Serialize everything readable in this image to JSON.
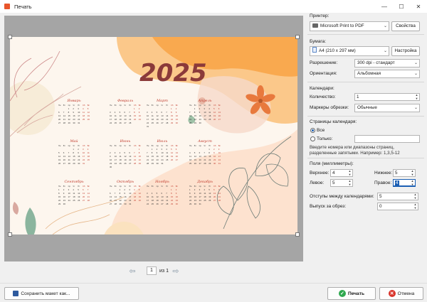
{
  "window": {
    "title": "Печать"
  },
  "calendar": {
    "year": "2025",
    "weekdays": [
      "Пн",
      "Вт",
      "Ср",
      "Чт",
      "Пт",
      "Сб",
      "Вс"
    ],
    "months": [
      "Январь",
      "Февраль",
      "Март",
      "Апрель",
      "Май",
      "Июнь",
      "Июль",
      "Август",
      "Сентябрь",
      "Октябрь",
      "Ноябрь",
      "Декабрь"
    ]
  },
  "pager": {
    "current": "1",
    "total_label": "из 1"
  },
  "printer": {
    "label": "Принтер:",
    "value": "Microsoft Print to PDF",
    "properties_button": "Свойства"
  },
  "paper": {
    "label": "Бумага:",
    "value": "A4 (210 x 297 мм)",
    "setup_button": "Настройка",
    "resolution_label": "Разрешение:",
    "resolution_value": "300 dpi - стандарт",
    "orientation_label": "Ориентация:",
    "orientation_value": "Альбомная"
  },
  "calendars": {
    "label": "Календари:",
    "count_label": "Количество:",
    "count_value": "1",
    "marks_label": "Маркеры обрезки:",
    "marks_value": "Обычные"
  },
  "pages": {
    "label": "Страницы календаря:",
    "all_label": "Все",
    "only_label": "Только:",
    "hint": "Введите номера или диапазоны страниц, разделенные запятыми. Например: 1,3,5-12"
  },
  "margins": {
    "label": "Поля (миллиметры):",
    "top_label": "Верхнее:",
    "top_value": "4",
    "bottom_label": "Нижнее:",
    "bottom_value": "5",
    "left_label": "Левое:",
    "left_value": "5",
    "right_label": "Правое:",
    "right_value": "4",
    "gap_label": "Отступы между календарями:",
    "gap_value": "5",
    "bleed_label": "Выпуск за обрез:",
    "bleed_value": "0"
  },
  "footer": {
    "save_layout": "Сохранить макет как...",
    "print": "Печать",
    "cancel": "Отмена"
  },
  "colors": {
    "accent": "#1b5fb4",
    "print_icon": "#2fa84f",
    "cancel_icon": "#d9342b",
    "year": "#8b3a3a",
    "month": "#c0392b"
  }
}
